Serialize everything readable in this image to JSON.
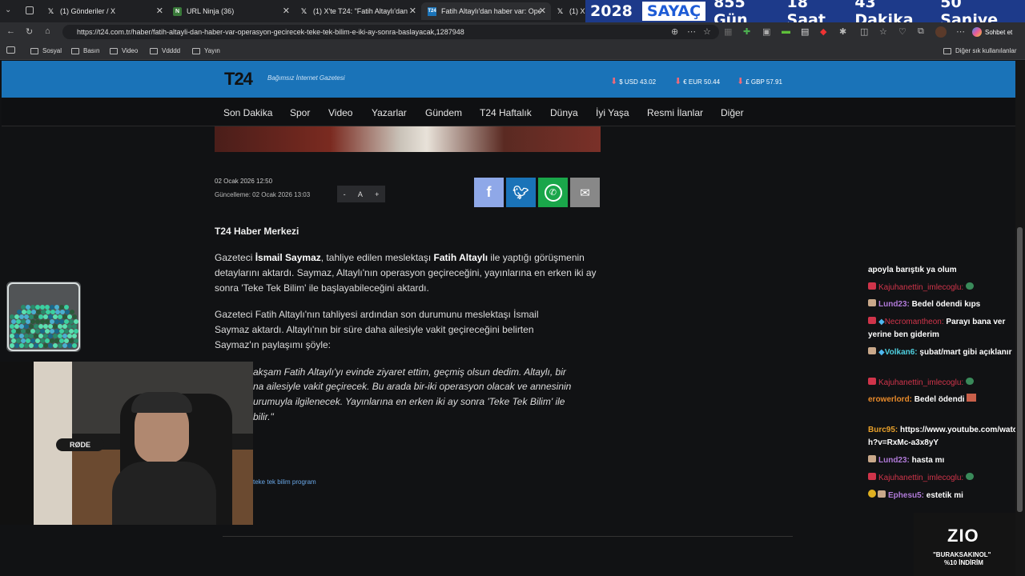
{
  "tabs": [
    {
      "title": "(1) Gönderiler / X",
      "icon": "x-logo-icon"
    },
    {
      "title": "URL Ninja (36)",
      "icon": "ninja-icon"
    },
    {
      "title": "(1) X'te T24: \"Fatih Altaylı'dan hab",
      "icon": "x-logo-icon"
    },
    {
      "title": "Fatih Altaylı'dan haber var: Opera",
      "icon": "t24-icon"
    },
    {
      "title": "(1) X'te",
      "icon": "x-logo-icon"
    }
  ],
  "countdown": {
    "year": "2028",
    "label": "SAYAÇ",
    "days": "855 Gün",
    "hours": "18 Saat",
    "minutes": "43 Dakika",
    "seconds": "50 Saniye"
  },
  "address_bar": {
    "url": "https://t24.com.tr/haber/fatih-altayli-dan-haber-var-operasyon-gecirecek-teke-tek-bilim-e-iki-ay-sonra-baslayacak,1287948",
    "chat_button": "Sohbet et"
  },
  "bookmarks": {
    "items": [
      "Sosyal",
      "Basın",
      "Video",
      "Vdddd",
      "Yayın"
    ],
    "other": "Diğer sık kullanılanlar"
  },
  "site": {
    "logo": "T24",
    "tagline": "Bağımsız İnternet Gazetesi",
    "currencies": [
      {
        "symbol": "$",
        "label": "USD 43.02"
      },
      {
        "symbol": "€",
        "label": "EUR 50.44"
      },
      {
        "symbol": "£",
        "label": "GBP 57.91"
      }
    ],
    "menu": [
      "Son Dakika",
      "Spor",
      "Video",
      "Yazarlar",
      "Gündem",
      "T24 Haftalık",
      "Dünya",
      "İyi Yaşa",
      "Resmi İlanlar",
      "Diğer"
    ]
  },
  "article": {
    "date": "02 Ocak 2026 12:50",
    "updated": "Güncelleme: 02 Ocak 2026 13:03",
    "font_controls": {
      "minus": "-",
      "a": "A",
      "plus": "+"
    },
    "author": "T24 Haber Merkezi",
    "p1_a": "Gazeteci ",
    "p1_b": "İsmail Saymaz",
    "p1_c": ", tahliye edilen meslektaşı ",
    "p1_d": "Fatih Altaylı",
    "p1_e": " ile yaptığı görüşmenin detaylarını aktardı. Saymaz, Altaylı'nın operasyon geçireceğini, yayınlarına en erken iki ay sonra 'Teke Tek Bilim' ile başlayabileceğini aktardı.",
    "p2": "Gazeteci Fatih Altaylı'nın tahliyesi ardından son durumunu meslektaşı İsmail Saymaz aktardı. Altaylı'nın bir süre daha ailesiyle vakit geçireceğini belirten Saymaz'ın paylaşımı şöyle:",
    "quote_lines": [
      "akşam Fatih Altaylı'yı evinde ziyaret ettim, geçmiş olsun dedim. Altaylı, bir",
      "na ailesiyle vakit geçirecek. Bu arada bir-iki operasyon olacak ve annesinin",
      "urumuyla ilgilenecek. Yayınlarına en erken iki ay sonra 'Teke Tek Bilim' ile",
      "bilir.\""
    ],
    "tags": "teke tek bilim  program"
  },
  "chat": [
    {
      "user": "",
      "text": "apoyla barıştık ya olum",
      "color": "#ffffff"
    },
    {
      "user": "Kajuhanettin_imlecoglu:",
      "text": "",
      "color": "#d0344a"
    },
    {
      "user": "Lund23:",
      "text": "Bedel ödendi kıps",
      "color": "#b07ad8"
    },
    {
      "user": "Necromantheon:",
      "text": "Parayı bana ver yerine ben giderim",
      "color": "#d0344a"
    },
    {
      "user": "Volkan6:",
      "text": "şubat/mart gibi açıklanır",
      "color": "#4fd0e0"
    },
    {
      "user": "Kajuhanettin_imlecoglu:",
      "text": "",
      "color": "#d0344a"
    },
    {
      "user": "erowerlord:",
      "text": "Bedel ödendi",
      "color": "#e88a2a"
    },
    {
      "user": "Burc95:",
      "text": "https://www.youtube.com/watch?v=RxMc-a3x8yY",
      "color": "#e8a02a"
    },
    {
      "user": "Lund23:",
      "text": "hasta mı",
      "color": "#b07ad8"
    },
    {
      "user": "Kajuhanettin_imlecoglu:",
      "text": "",
      "color": "#d0344a"
    },
    {
      "user": "Ephesu5:",
      "text": "estetik mi",
      "color": "#b07ad8"
    }
  ],
  "promo": {
    "brand": "ZIO",
    "line1": "\"BURAKSAKINOL\"",
    "line2": "%10 İNDİRİM"
  },
  "webcam": {
    "mic_brand": "RØDE"
  },
  "colors": {
    "header_blue": "#1a73b8",
    "countdown_blue": "#1d3a8a",
    "page_bg": "#111214"
  }
}
